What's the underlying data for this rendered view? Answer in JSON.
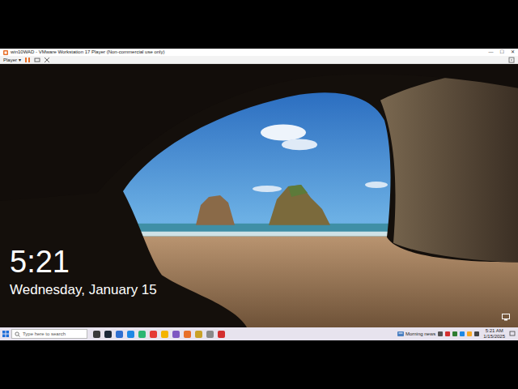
{
  "vm_window": {
    "title": "win10WAD - VMware Workstation 17 Player (Non-commercial use only)",
    "controls": [
      "—",
      "☐",
      "✕"
    ],
    "toolbar": {
      "menu": "Player",
      "menu_arrow": "▾"
    }
  },
  "lock_screen": {
    "time": "5:21",
    "date": "Wednesday, January 15"
  },
  "taskbar": {
    "search_placeholder": "Type here to search",
    "apps": [
      {
        "color": "#3a3a3a"
      },
      {
        "color": "#1b2838"
      },
      {
        "color": "#2f6fd0"
      },
      {
        "color": "#1e88e5"
      },
      {
        "color": "#2bb673"
      },
      {
        "color": "#e53935"
      },
      {
        "color": "#f4b400"
      },
      {
        "color": "#7e57c2"
      },
      {
        "color": "#e8702a"
      },
      {
        "color": "#c9a227"
      },
      {
        "color": "#8a8a8a"
      },
      {
        "color": "#d32f2f"
      }
    ],
    "news": "Morning news",
    "tray": [
      {
        "color": "#555555"
      },
      {
        "color": "#d32f2f"
      },
      {
        "color": "#2e7d32"
      },
      {
        "color": "#1e88e5"
      },
      {
        "color": "#f9a825"
      },
      {
        "color": "#444444"
      }
    ],
    "clock_time": "5:21 AM",
    "clock_date": "1/15/2025"
  }
}
